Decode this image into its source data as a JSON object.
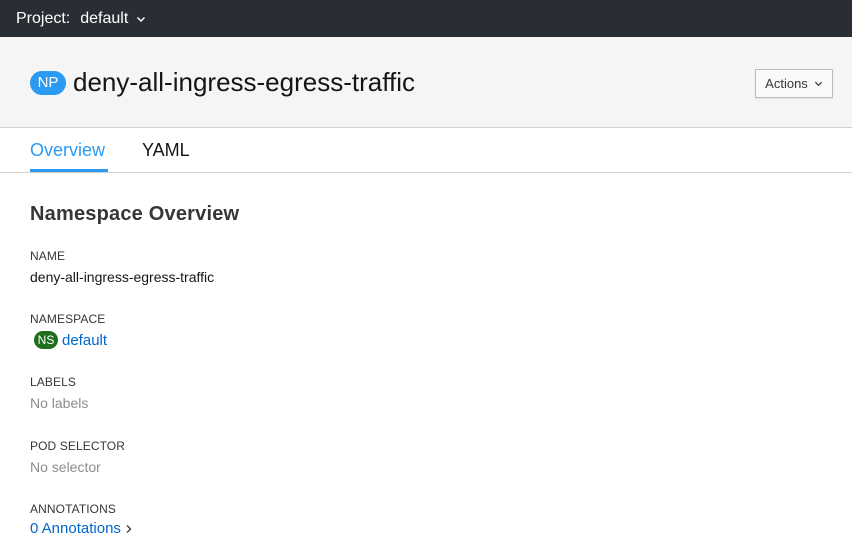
{
  "topbar": {
    "project_label": "Project:",
    "project_value": "default"
  },
  "header": {
    "kind_badge": "NP",
    "title": "deny-all-ingress-egress-traffic",
    "actions_label": "Actions"
  },
  "tabs": [
    {
      "label": "Overview",
      "active": true
    },
    {
      "label": "YAML",
      "active": false
    }
  ],
  "overview": {
    "section_title": "Namespace Overview",
    "fields": {
      "name_label": "NAME",
      "name_value": "deny-all-ingress-egress-traffic",
      "namespace_label": "NAMESPACE",
      "namespace_badge": "NS",
      "namespace_value": "default",
      "labels_label": "LABELS",
      "labels_value": "No labels",
      "pod_selector_label": "POD SELECTOR",
      "pod_selector_value": "No selector",
      "annotations_label": "ANNOTATIONS",
      "annotations_value": "0 Annotations"
    }
  },
  "colors": {
    "accent": "#2b9af3",
    "topbar": "#292e34",
    "ns_badge": "#1e6e1e",
    "link": "#0066cc"
  }
}
